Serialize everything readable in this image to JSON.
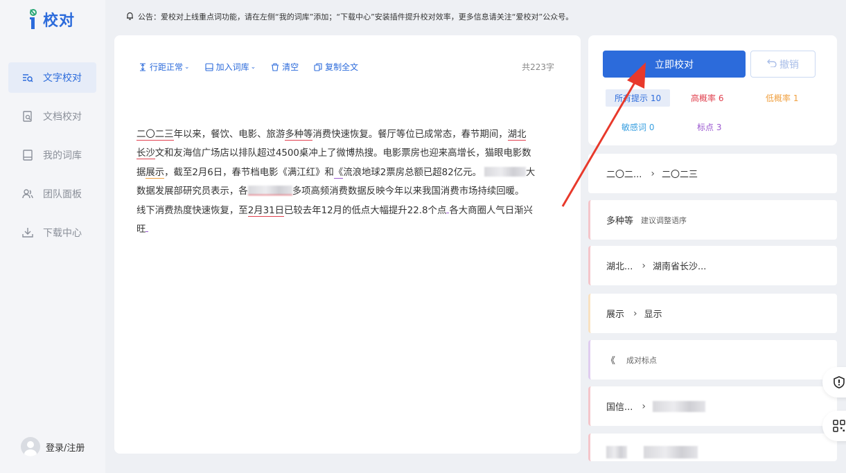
{
  "app": {
    "logo_text": "校对"
  },
  "notice": {
    "text": "公告：爱校对上线重点词功能，请在左侧“我的词库”添加；“下载中心”安装插件提升校对效率，更多信息请关注“爱校对”公众号。"
  },
  "sidebar": {
    "items": [
      {
        "label": "文字校对",
        "icon": "text-check-icon"
      },
      {
        "label": "文档校对",
        "icon": "document-check-icon"
      },
      {
        "label": "我的词库",
        "icon": "book-icon"
      },
      {
        "label": "团队面板",
        "icon": "team-icon"
      },
      {
        "label": "下载中心",
        "icon": "download-icon"
      }
    ],
    "login_label": "登录/注册"
  },
  "toolbar": {
    "line_spacing": "行距正常",
    "add_dict": "加入词库",
    "clear": "清空",
    "copy_all": "复制全文",
    "char_count": "共223字"
  },
  "content": {
    "s1": "二〇二三",
    "s2": "年以来，餐饮、电影、旅游",
    "s3": "多种等",
    "s4": "消费快速恢复。餐厅等位已成常态，春节期间，",
    "s5": "湖北",
    "s6": "长沙",
    "s7": "文和友海信广场店以排队超过4500桌冲上了微博热搜。电影票房也迎来高增长，猫眼电影数",
    "s8": "据",
    "s9": "展示",
    "s10": "，截至2月6日，春节档电影《满江红》和",
    "s11": "《",
    "s12": "流浪地球2票房总额已超82亿元。",
    "s13": "大",
    "s14": "数据发展部研究员表示，各",
    "s15": "多项高频消费数据反映今年以来我国消费市场持续回暖。",
    "s16": "线下消费热度快速恢复，至",
    "s17": "2月31日",
    "s18": "已较去年12月的低点大幅提升22.8个点",
    "s19": "各大商圈人气日渐兴",
    "s20": "旺"
  },
  "panel": {
    "check_button": "立即校对",
    "undo_button": "撤销",
    "stats": {
      "all": "所有提示 10",
      "high": "高概率 6",
      "low": "低概率 1",
      "sensitive": "敏感词 0",
      "punctuation": "标点 3"
    }
  },
  "suggestions": [
    {
      "from": "二〇二...",
      "to": "二〇二三"
    },
    {
      "from": "多种等",
      "hint": "建议调整语序"
    },
    {
      "from": "湖北...",
      "to": "湖南省长沙..."
    },
    {
      "from": "展示",
      "to": "显示"
    },
    {
      "from": "《",
      "hint": "成对标点"
    },
    {
      "from": "国信..."
    }
  ],
  "colors": {
    "accent": "#2c6bdb",
    "high": "#e0404e",
    "low": "#f0a040",
    "sensitive": "#3aa0e0",
    "punctuation": "#9b59d0",
    "annotation_arrow": "#e8392b"
  }
}
